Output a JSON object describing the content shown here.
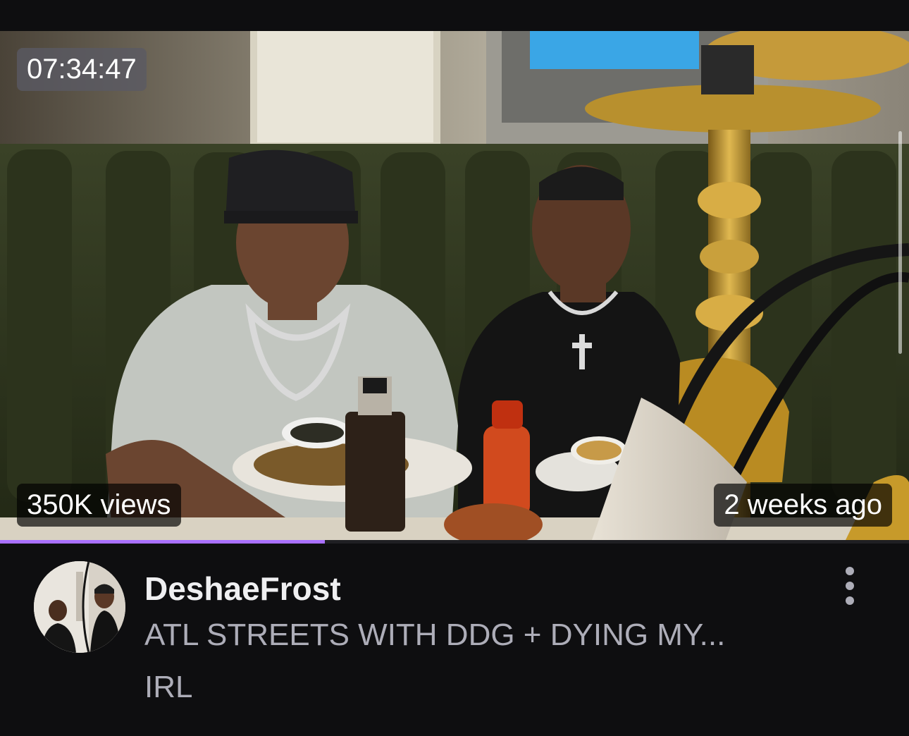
{
  "video": {
    "duration": "07:34:47",
    "views": "350K views",
    "age": "2 weeks ago",
    "watch_progress": 0.357,
    "progress_color": "#a970ff",
    "thumbnail_icon": "video-thumbnail"
  },
  "channel": {
    "name": "DeshaeFrost",
    "avatar_icon": "channel-avatar"
  },
  "stream": {
    "title": "ATL STREETS WITH DDG + DYING MY...",
    "category": "IRL"
  },
  "actions": {
    "more_icon": "more-vertical-icon"
  },
  "colors": {
    "background": "#0e0e10",
    "primary_text": "#efeff1",
    "secondary_text": "#adadb8",
    "accent": "#a970ff"
  }
}
